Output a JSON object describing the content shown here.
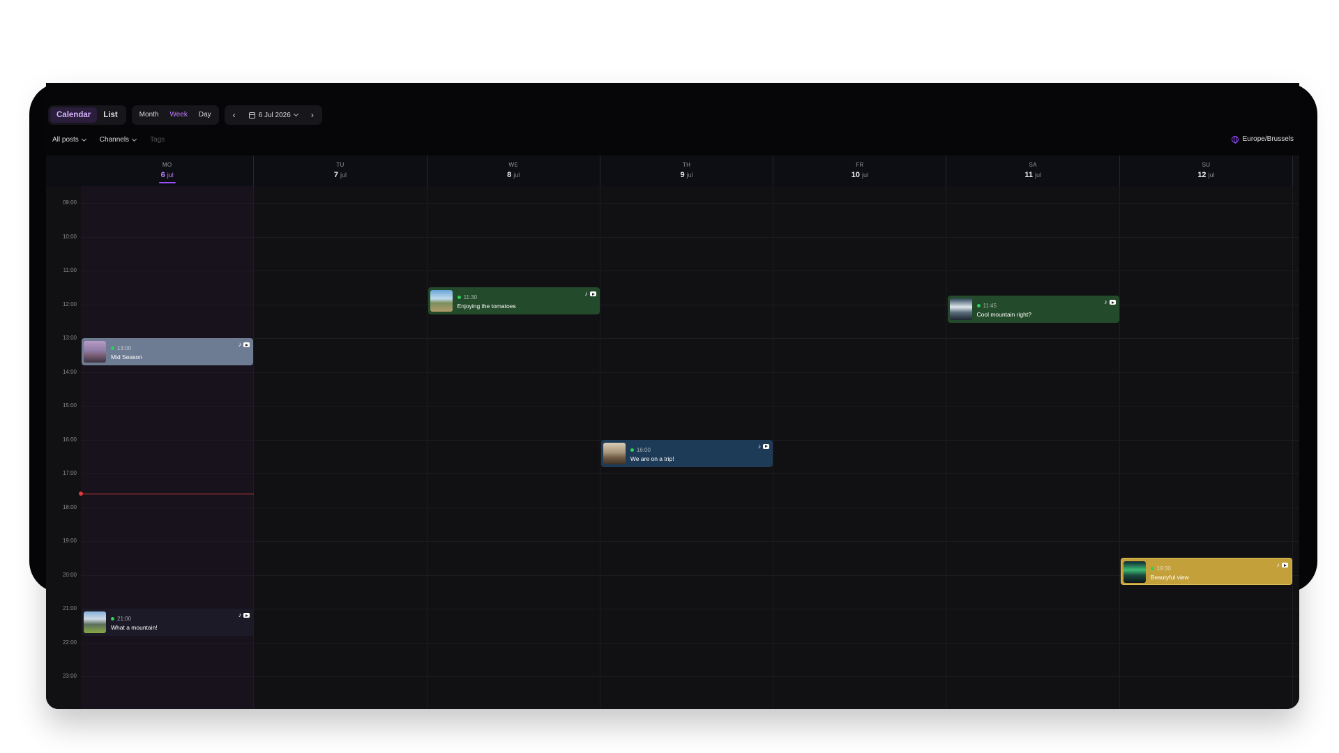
{
  "view_toggle": {
    "calendar": "Calendar",
    "list": "List"
  },
  "range_toggle": {
    "month": "Month",
    "week": "Week",
    "day": "Day"
  },
  "date_nav": {
    "prev": "‹",
    "next": "›",
    "current": "6 Jul 2026"
  },
  "filters": {
    "all_posts": "All posts",
    "channels": "Channels",
    "tags": "Tags"
  },
  "timezone": "Europe/Brussels",
  "days": [
    {
      "dow": "MO",
      "num": "6",
      "mon": "jul",
      "today": true
    },
    {
      "dow": "TU",
      "num": "7",
      "mon": "jul"
    },
    {
      "dow": "WE",
      "num": "8",
      "mon": "jul"
    },
    {
      "dow": "TH",
      "num": "9",
      "mon": "jul"
    },
    {
      "dow": "FR",
      "num": "10",
      "mon": "jul"
    },
    {
      "dow": "SA",
      "num": "11",
      "mon": "jul"
    },
    {
      "dow": "SU",
      "num": "12",
      "mon": "jul"
    }
  ],
  "hours": [
    "09:00",
    "10:00",
    "11:00",
    "12:00",
    "13:00",
    "14:00",
    "15:00",
    "16:00",
    "17:00",
    "18:00",
    "19:00",
    "20:00",
    "21:00",
    "22:00",
    "23:00"
  ],
  "events": [
    {
      "day": 0,
      "time": "13:00",
      "title": "Mid Season",
      "color": "#6d7b93",
      "thumb": "sunset"
    },
    {
      "day": 0,
      "time": "21:00",
      "title": "What a mountain!",
      "color": "#1b1a26",
      "thumb": "mountain"
    },
    {
      "day": 2,
      "time": "11:30",
      "title": "Enjoying the tomatoes",
      "color": "#234a2a",
      "thumb": "field"
    },
    {
      "day": 3,
      "time": "16:00",
      "title": "We are on a trip!",
      "color": "#1d3a56",
      "thumb": "trip"
    },
    {
      "day": 5,
      "time": "11:45",
      "title": "Cool mountain right?",
      "color": "#234a2a",
      "thumb": "snow"
    },
    {
      "day": 6,
      "time": "19:30",
      "title": "Beautyful view",
      "color": "#c4a03a",
      "thumb": "aurora"
    }
  ],
  "colors": {
    "accent": "#9a4dff",
    "now_line": "#d03838",
    "status_dot": "#2bd15a"
  }
}
